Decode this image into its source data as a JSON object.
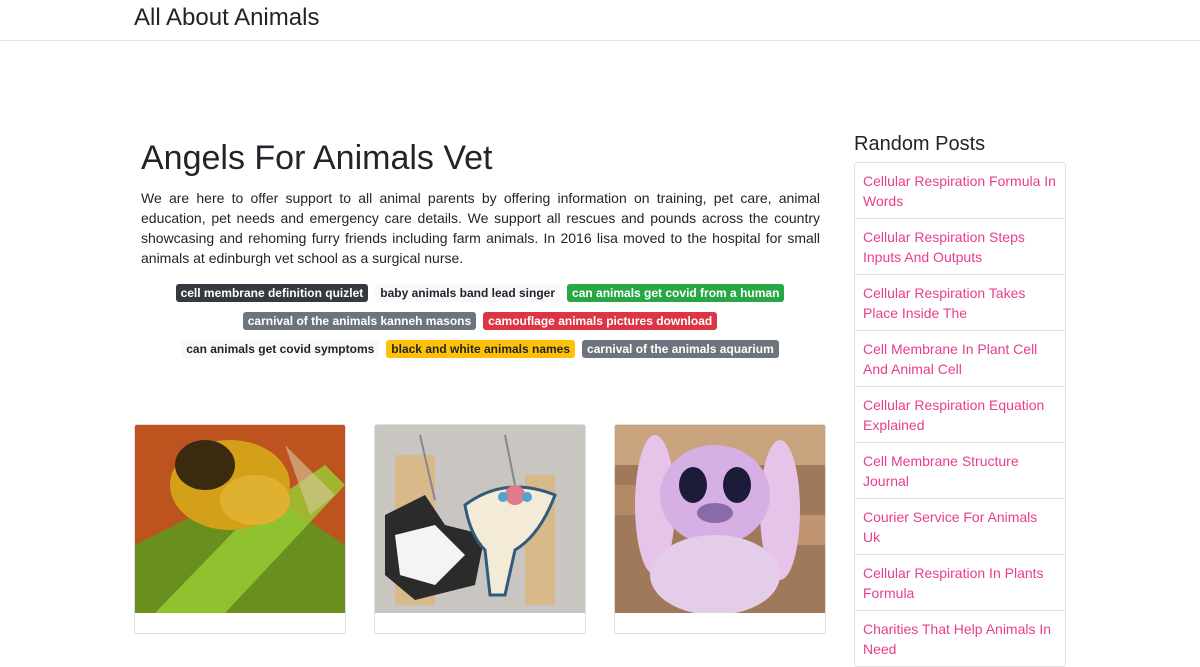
{
  "site": {
    "brand": "All About Animals"
  },
  "article": {
    "title": "Angels For Animals Vet",
    "intro": "We are here to offer support to all animal parents by offering information on training, pet care, animal education, pet needs and emergency care details. We support all rescues and pounds across the country showcasing and rehoming furry friends including farm animals. In 2016 lisa moved to the hospital for small animals at edinburgh vet school as a surgical nurse."
  },
  "tags": {
    "row1": [
      "cell membrane definition quizlet",
      "baby animals band lead singer",
      "can animals get covid from a human"
    ],
    "row2": [
      "carnival of the animals kanneh masons",
      "camouflage animals pictures download"
    ],
    "row3": [
      "can animals get covid symptoms",
      "black and white animals names",
      "carnival of the animals aquarium"
    ]
  },
  "sidebar": {
    "title": "Random Posts",
    "items": [
      "Cellular Respiration Formula In Words",
      "Cellular Respiration Steps Inputs And Outputs",
      "Cellular Respiration Takes Place Inside The",
      "Cell Membrane In Plant Cell And Animal Cell",
      "Cellular Respiration Equation Explained",
      "Cell Membrane Structure Journal",
      "Courier Service For Animals Uk",
      "Cellular Respiration In Plants Formula",
      "Charities That Help Animals In Need"
    ]
  },
  "colors": {
    "link": "#e83e8c",
    "success": "#28a745",
    "danger": "#dc3545",
    "warning": "#ffc107",
    "secondary": "#6c757d",
    "dark": "#343a40"
  },
  "icons": {
    "card_1": "bee-photo",
    "card_2": "keychain-photo",
    "card_3": "plush-toy-photo"
  }
}
